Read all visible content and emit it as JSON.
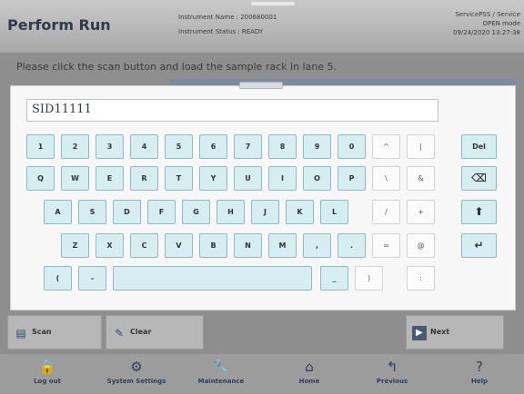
{
  "header": {
    "title": "Perform Run",
    "instrument_name": "Instrument Name : 200680001",
    "instrument_status": "Instrument Status : READY",
    "user": "ServicePSS / Service",
    "mode": "OPEN mode",
    "datetime": "09/24/2020 13:27:38"
  },
  "instruction": "Please click the scan button and load the sample rack in lane 5.",
  "keyboard": {
    "input_value": "SID11111",
    "row1": [
      "1",
      "2",
      "3",
      "4",
      "5",
      "6",
      "7",
      "8",
      "9",
      "0",
      "^",
      "|"
    ],
    "row2": [
      "Q",
      "W",
      "E",
      "R",
      "T",
      "Y",
      "U",
      "I",
      "O",
      "P",
      "\\",
      "&"
    ],
    "row3": [
      "A",
      "S",
      "D",
      "F",
      "G",
      "H",
      "J",
      "K",
      "L",
      "/",
      "+"
    ],
    "row4": [
      "Z",
      "X",
      "C",
      "V",
      "B",
      "N",
      "M",
      ",",
      ".",
      "=",
      "@"
    ],
    "row5": [
      "(",
      "-",
      "_",
      ")",
      ":"
    ],
    "del_label": "Del",
    "backspace_glyph": "⌫",
    "shift_glyph": "⬆",
    "enter_glyph": "↵"
  },
  "actions": {
    "scan": "Scan",
    "clear": "Clear",
    "next": "Next"
  },
  "nav": {
    "logout": "Log out",
    "system_settings": "System Settings",
    "maintenance": "Maintenance",
    "home": "Home",
    "previous": "Previous",
    "help": "Help"
  },
  "icons": [
    "scan-icon",
    "clear-icon",
    "next-icon",
    "lock-icon",
    "gear-icon",
    "wrench-icon",
    "home-icon",
    "previous-icon",
    "help-icon"
  ],
  "colors": {
    "key_fill": "#d6edf2",
    "key_border": "#92b8c2",
    "title": "#2f3a4e"
  }
}
